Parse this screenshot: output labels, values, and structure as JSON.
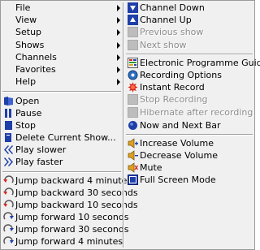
{
  "menu": {
    "left_top": [
      {
        "label": "File",
        "has_submenu": true
      },
      {
        "label": "View",
        "has_submenu": true
      },
      {
        "label": "Setup",
        "has_submenu": true
      },
      {
        "label": "Shows",
        "has_submenu": true
      },
      {
        "label": "Channels",
        "has_submenu": true
      },
      {
        "label": "Favorites",
        "has_submenu": true
      },
      {
        "label": "Help",
        "has_submenu": true
      }
    ],
    "left_playback": [
      {
        "label": "Open",
        "icon": "open-icon"
      },
      {
        "label": "Pause",
        "icon": "pause-icon"
      },
      {
        "label": "Stop",
        "icon": "stop-icon"
      },
      {
        "label": "Delete Current Show...",
        "icon": "delete-icon"
      },
      {
        "label": "Play slower",
        "icon": "rewind-icon"
      },
      {
        "label": "Play faster",
        "icon": "fast-forward-icon"
      }
    ],
    "left_jump": [
      {
        "label": "Jump backward 4 minutes",
        "icon": "jump-backward-icon"
      },
      {
        "label": "Jump backward 30 seconds",
        "icon": "jump-backward-icon"
      },
      {
        "label": "Jump backward 10 seconds",
        "icon": "jump-backward-icon"
      },
      {
        "label": "Jump forward 10 seconds",
        "icon": "jump-forward-icon"
      },
      {
        "label": "Jump forward 30 seconds",
        "icon": "jump-forward-icon"
      },
      {
        "label": "Jump forward 4 minutes",
        "icon": "jump-forward-icon"
      }
    ],
    "right_channels": [
      {
        "label": "Channel Down",
        "icon": "channel-down-icon",
        "enabled": true
      },
      {
        "label": "Channel Up",
        "icon": "channel-up-icon",
        "enabled": true
      },
      {
        "label": "Previous show",
        "icon": "disabled-icon",
        "enabled": false
      },
      {
        "label": "Next show",
        "icon": "disabled-icon",
        "enabled": false
      }
    ],
    "right_recording": [
      {
        "label": "Electronic Programme Guide",
        "icon": "programme-guide-icon",
        "enabled": true
      },
      {
        "label": "Recording Options",
        "icon": "recording-options-icon",
        "enabled": true
      },
      {
        "label": "Instant Record",
        "icon": "instant-record-icon",
        "enabled": true
      },
      {
        "label": "Stop Recording",
        "icon": "disabled-icon",
        "enabled": false
      },
      {
        "label": "Hibernate after recording",
        "icon": "disabled-icon",
        "enabled": false
      },
      {
        "label": "Now and Next Bar",
        "icon": "now-next-icon",
        "enabled": true
      }
    ],
    "right_audio": [
      {
        "label": "Increase Volume",
        "icon": "volume-up-icon",
        "enabled": true
      },
      {
        "label": "Decrease Volume",
        "icon": "volume-down-icon",
        "enabled": true
      },
      {
        "label": "Mute",
        "icon": "mute-icon",
        "enabled": true
      },
      {
        "label": "Full Screen Mode",
        "icon": "fullscreen-icon",
        "enabled": true
      }
    ]
  },
  "colors": {
    "menu_bg": "#f0f0f0",
    "disabled_text": "#8d8d8d",
    "icon_blue": "#1f3fa8",
    "record_red": "#d9261c"
  }
}
